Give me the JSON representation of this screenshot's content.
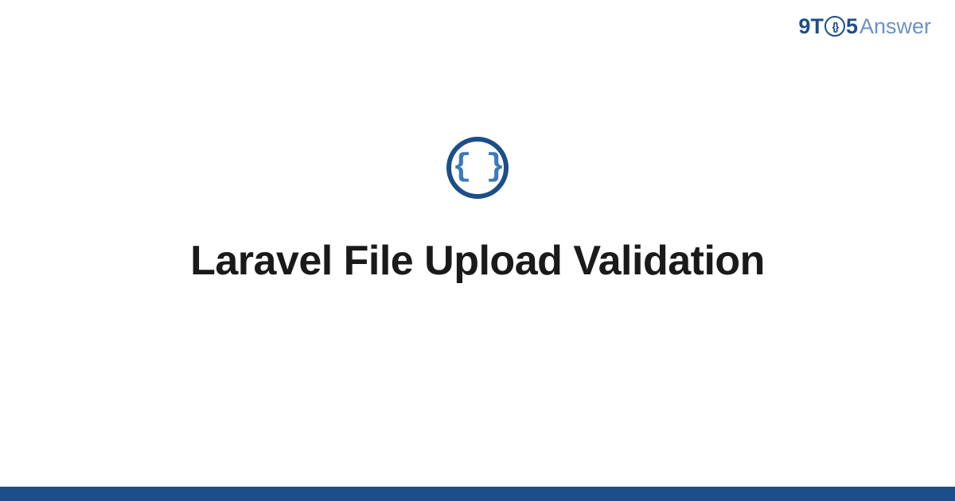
{
  "logo": {
    "prefix_9t": "9T",
    "circle_content": "{}",
    "five": "5",
    "answer": "Answer"
  },
  "main_icon": {
    "symbol": "{ }"
  },
  "title": "Laravel File Upload Validation",
  "colors": {
    "primary": "#1d4e89",
    "secondary": "#6a93c4",
    "icon_inner": "#3b7bb8"
  }
}
